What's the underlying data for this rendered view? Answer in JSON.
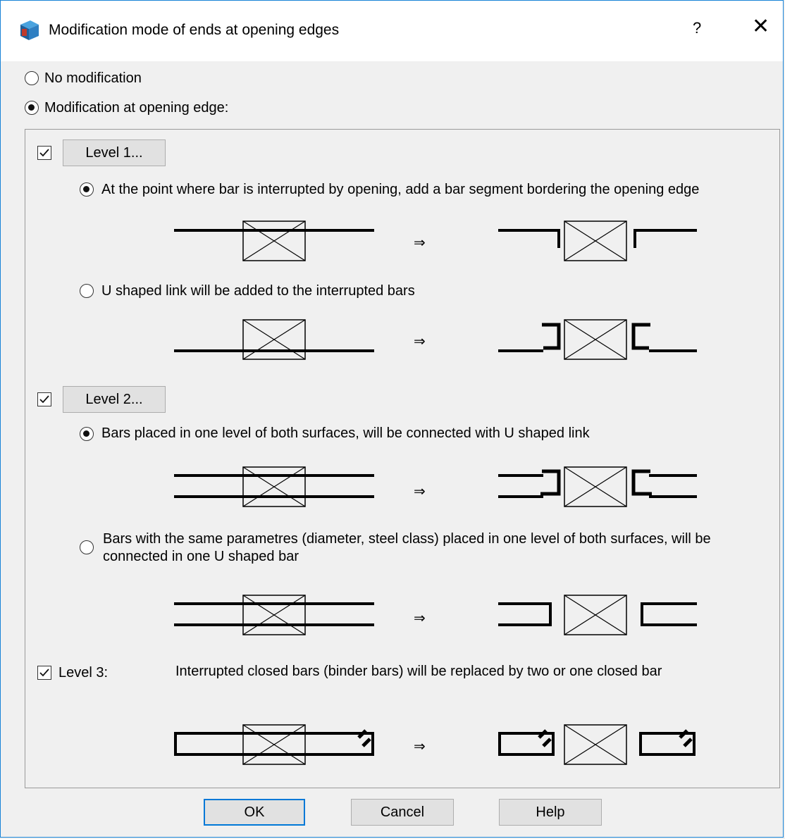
{
  "window": {
    "title": "Modification mode of ends at opening edges",
    "help_symbol": "?",
    "close_symbol": "✕",
    "icon": "app-cube-icon"
  },
  "mode": {
    "no_modification": "No modification",
    "modification_at_edge": "Modification at opening edge:",
    "selected": "modification_at_edge"
  },
  "level1": {
    "checked": true,
    "button": "Level 1...",
    "option_a": "At the point where bar is interrupted by opening, add a bar segment bordering the opening edge",
    "option_b": "U shaped link will be added to the interrupted bars",
    "selected": "option_a"
  },
  "level2": {
    "checked": true,
    "button": "Level 2...",
    "option_a": "Bars placed in one level of both surfaces, will be connected with U shaped link",
    "option_b_line1": "Bars with the same parametres (diameter, steel class) placed in one level of both surfaces, will be",
    "option_b_line2": "connected in one U shaped bar",
    "selected": "option_a"
  },
  "level3": {
    "checked": true,
    "label": "Level 3:",
    "description": "Interrupted closed bars (binder bars) will be replaced by two or one closed bar"
  },
  "arrow_symbol": "⇒",
  "buttons": {
    "ok": "OK",
    "cancel": "Cancel",
    "help": "Help"
  }
}
